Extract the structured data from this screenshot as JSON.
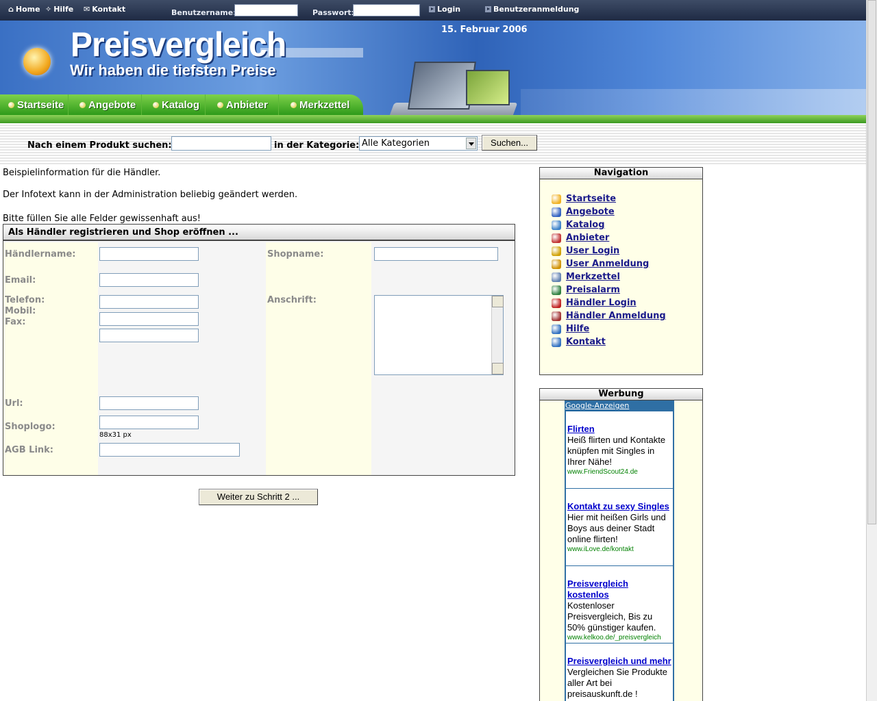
{
  "topbar": {
    "home": "Home",
    "help": "Hilfe",
    "contact": "Kontakt",
    "username_label": "Benutzername:",
    "password_label": "Passwort:",
    "login": "Login",
    "register": "Benutzeranmeldung"
  },
  "header": {
    "title": "Preisvergleich",
    "subtitle": "Wir haben die tiefsten Preise",
    "date": "15. Februar 2006"
  },
  "mainnav": [
    "Startseite",
    "Angebote",
    "Katalog",
    "Anbieter",
    "Merkzettel"
  ],
  "search": {
    "label": "Nach einem Produkt suchen:",
    "category_label": "in der Kategorie:",
    "category_value": "Alle Kategorien",
    "button": "Suchen..."
  },
  "info": {
    "line1": "Beispielinformation für die Händler.",
    "line2": "Der Infotext kann in der Administration beliebig geändert werden.",
    "line3": "Bitte füllen Sie alle Felder gewissenhaft aus!"
  },
  "form": {
    "title": "Als Händler registrieren und Shop eröffnen ...",
    "haendlername": "Händlername:",
    "email": "Email:",
    "telefon": "Telefon:",
    "mobil": "Mobil:",
    "fax": "Fax:",
    "url": "Url:",
    "shoplogo": "Shoplogo:",
    "shoplogo_hint": "88x31 px",
    "agb": "AGB Link:",
    "shopname": "Shopname:",
    "anschrift": "Anschrift:",
    "next_button": "Weiter zu Schritt 2 ..."
  },
  "sidebar": {
    "nav_title": "Navigation",
    "items": [
      {
        "label": "Startseite",
        "color": "#f0b020"
      },
      {
        "label": "Angebote",
        "color": "#3060c0"
      },
      {
        "label": "Katalog",
        "color": "#3a80c8"
      },
      {
        "label": "Anbieter",
        "color": "#c03030"
      },
      {
        "label": "User Login",
        "color": "#d0a000"
      },
      {
        "label": "User Anmeldung",
        "color": "#d09000"
      },
      {
        "label": "Merkzettel",
        "color": "#6080b0"
      },
      {
        "label": "Preisalarm",
        "color": "#308040"
      },
      {
        "label": "Händler Login",
        "color": "#c02020"
      },
      {
        "label": "Händler Anmeldung",
        "color": "#a03030"
      },
      {
        "label": "Hilfe",
        "color": "#3070c0"
      },
      {
        "label": "Kontakt",
        "color": "#3070c0"
      }
    ],
    "ads_title": "Werbung"
  },
  "ads": {
    "header": "Google-Anzeigen",
    "items": [
      {
        "title": "Flirten",
        "body": "Heiß flirten und Kontakte knüpfen mit Singles in Ihrer Nähe!",
        "url": "www.FriendScout24.de"
      },
      {
        "title": "Kontakt zu sexy Singles",
        "body": "Hier mit heißen Girls und Boys aus deiner Stadt online flirten!",
        "url": "www.iLove.de/kontakt"
      },
      {
        "title": "Preisvergleich kostenlos",
        "body": "Kostenloser Preisvergleich, Bis zu 50% günstiger kaufen.",
        "url": "www.kelkoo.de/_preisvergleich"
      },
      {
        "title": "Preisvergleich und mehr",
        "body": "Vergleichen Sie Produkte aller Art bei preisauskunft.de !",
        "url": ""
      }
    ]
  }
}
